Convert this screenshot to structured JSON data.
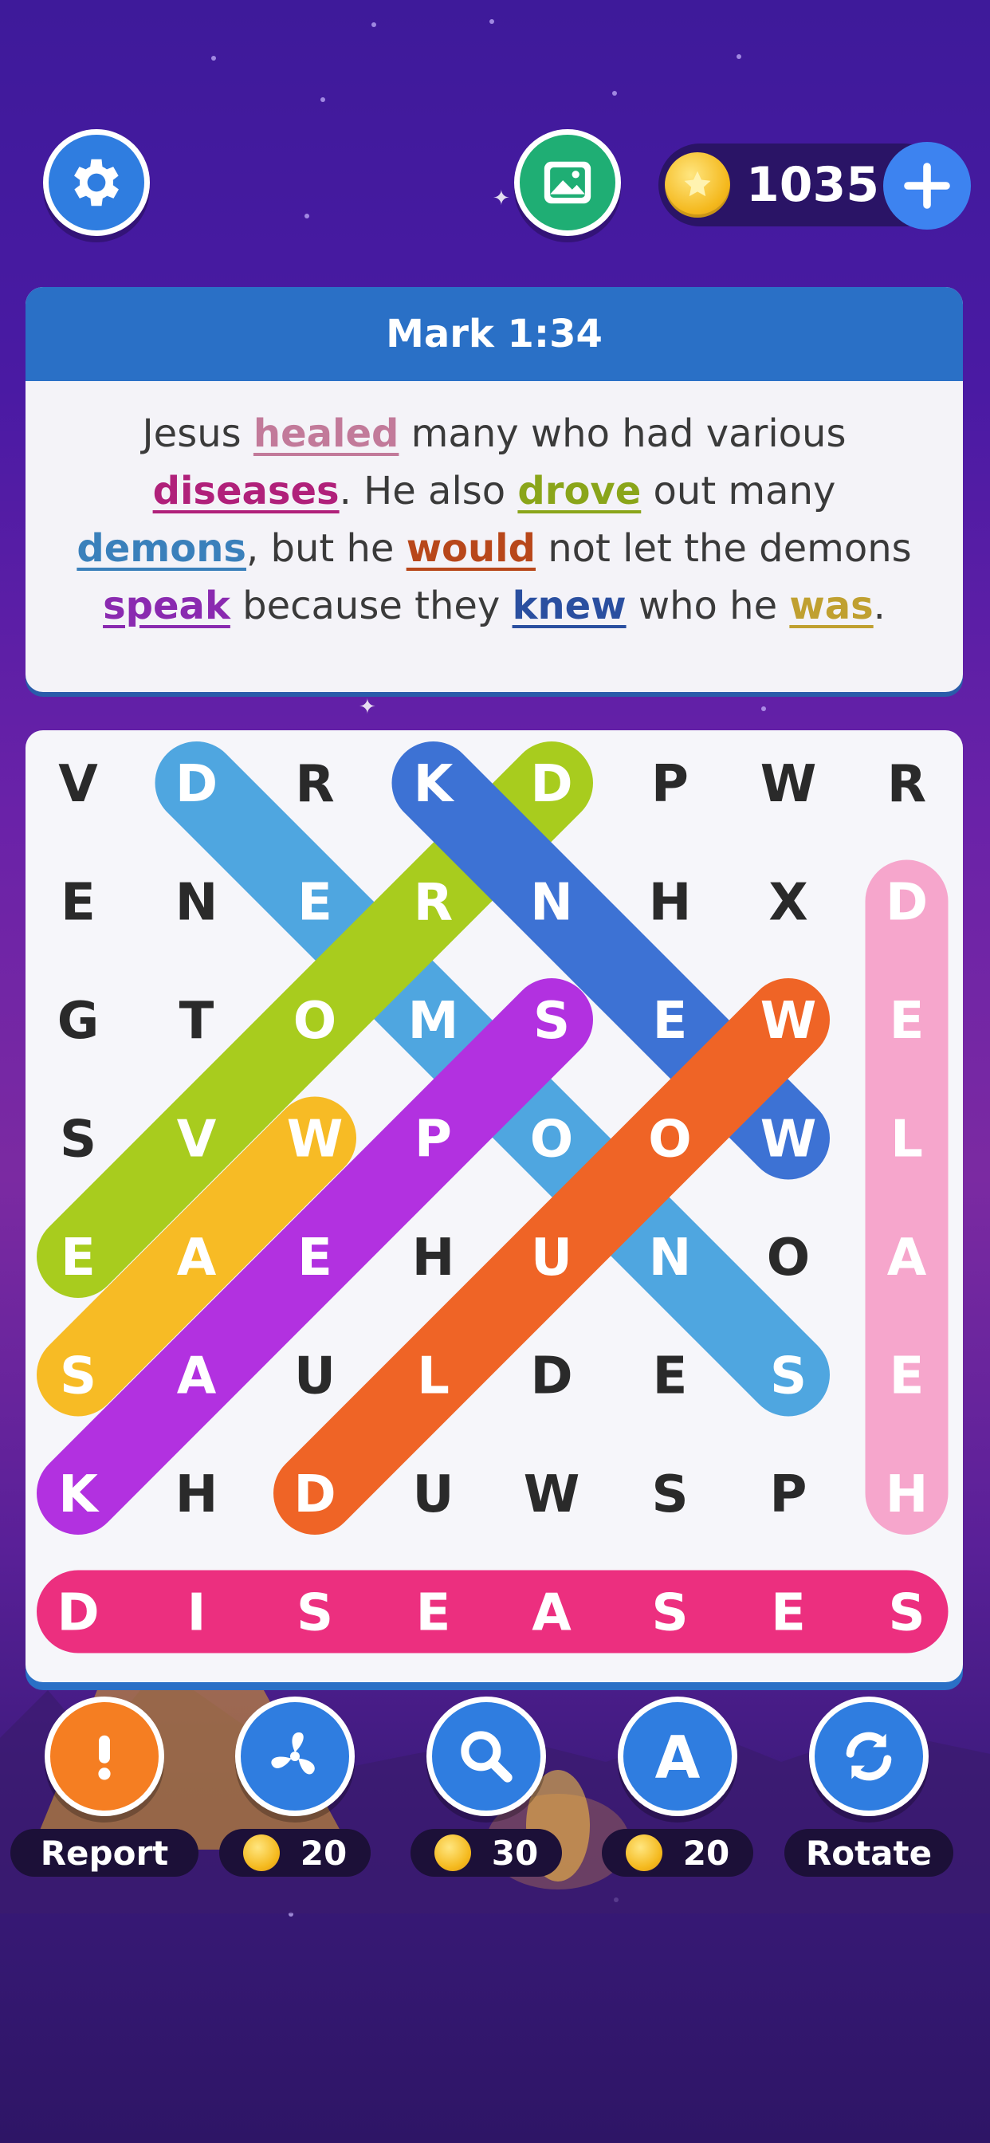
{
  "header": {
    "settings_icon": "gear-icon",
    "gallery_icon": "image-icon",
    "coins": "1035",
    "add_coins_icon": "plus-icon"
  },
  "verse": {
    "reference": "Mark 1:34",
    "segments": [
      {
        "text": "Jesus ",
        "word": false
      },
      {
        "text": "healed",
        "word": true,
        "color": "#c27a9a"
      },
      {
        "text": " many who had various ",
        "word": false
      },
      {
        "text": "diseases",
        "word": true,
        "color": "#b0207a"
      },
      {
        "text": ". He also ",
        "word": false
      },
      {
        "text": "drove",
        "word": true,
        "color": "#8aa51a"
      },
      {
        "text": " out many ",
        "word": false
      },
      {
        "text": "demons",
        "word": true,
        "color": "#3a80bb"
      },
      {
        "text": ", but he ",
        "word": false
      },
      {
        "text": "would",
        "word": true,
        "color": "#b8471a"
      },
      {
        "text": " not let the demons ",
        "word": false
      },
      {
        "text": "speak",
        "word": true,
        "color": "#8a2ab0"
      },
      {
        "text": " because they ",
        "word": false
      },
      {
        "text": "knew",
        "word": true,
        "color": "#2a4fa0"
      },
      {
        "text": " who he ",
        "word": false
      },
      {
        "text": "was",
        "word": true,
        "color": "#c0a030"
      },
      {
        "text": ".",
        "word": false
      }
    ]
  },
  "grid": {
    "rows": [
      [
        "V",
        "D",
        "R",
        "K",
        "D",
        "P",
        "W",
        "R"
      ],
      [
        "E",
        "N",
        "E",
        "R",
        "N",
        "H",
        "X",
        "D"
      ],
      [
        "G",
        "T",
        "O",
        "M",
        "S",
        "E",
        "W",
        "E"
      ],
      [
        "S",
        "V",
        "W",
        "P",
        "O",
        "O",
        "W",
        "L"
      ],
      [
        "E",
        "A",
        "E",
        "H",
        "U",
        "N",
        "O",
        "A"
      ],
      [
        "S",
        "A",
        "U",
        "L",
        "D",
        "E",
        "S",
        "E"
      ],
      [
        "K",
        "H",
        "D",
        "U",
        "W",
        "S",
        "P",
        "H"
      ],
      [
        "D",
        "I",
        "S",
        "E",
        "A",
        "S",
        "E",
        "S"
      ]
    ],
    "found_words": [
      {
        "word": "DEMONS",
        "color": "#4fa6e0",
        "start": [
          0,
          1
        ],
        "end": [
          5,
          6
        ]
      },
      {
        "word": "DROVE",
        "color": "#a8cc1e",
        "start": [
          0,
          4
        ],
        "end": [
          4,
          0
        ]
      },
      {
        "word": "KNEW",
        "color": "#3d72d4",
        "start": [
          0,
          3
        ],
        "end": [
          3,
          6
        ]
      },
      {
        "word": "WAS",
        "color": "#f7bb25",
        "start": [
          3,
          2
        ],
        "end": [
          5,
          0
        ]
      },
      {
        "word": "SPEAK",
        "color": "#b231e0",
        "start": [
          2,
          4
        ],
        "end": [
          6,
          0
        ]
      },
      {
        "word": "WOULD",
        "color": "#ef6426",
        "start": [
          2,
          6
        ],
        "end": [
          6,
          2
        ]
      },
      {
        "word": "HEALED",
        "color": "#f6a6cc",
        "start": [
          6,
          7
        ],
        "end": [
          1,
          7
        ]
      },
      {
        "word": "DISEASES",
        "color": "#ec2f7f",
        "start": [
          7,
          0
        ],
        "end": [
          7,
          7
        ]
      }
    ]
  },
  "tools": [
    {
      "name": "report",
      "icon": "exclamation-icon",
      "label": "Report",
      "color": "#f57e22"
    },
    {
      "name": "fan",
      "icon": "fan-icon",
      "cost": "20",
      "color": "#2f7de0"
    },
    {
      "name": "search",
      "icon": "magnifier-icon",
      "cost": "30",
      "color": "#2f7de0"
    },
    {
      "name": "letter",
      "icon": "letter-a-icon",
      "cost": "20",
      "color": "#2f7de0"
    },
    {
      "name": "rotate",
      "icon": "rotate-icon",
      "label": "Rotate",
      "color": "#2f7de0"
    }
  ]
}
